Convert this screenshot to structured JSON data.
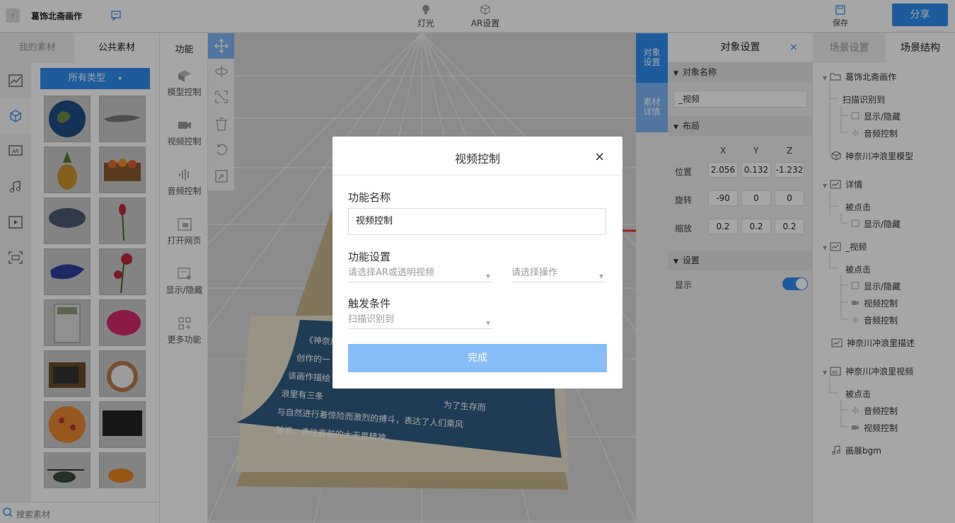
{
  "app": {
    "title": "葛饰北斋画作",
    "back_icon": "back-icon",
    "edit_icon": "comment-edit-icon"
  },
  "toolbar": {
    "light": {
      "label": "灯光",
      "icon": "bulb-icon"
    },
    "ar": {
      "label": "AR设置",
      "icon": "cube-icon"
    },
    "save": {
      "label": "保存",
      "icon": "save-icon"
    },
    "share": {
      "label": "分享"
    }
  },
  "left_panel": {
    "tabs": [
      "我的素材",
      "公共素材"
    ],
    "active_tab": "公共素材",
    "filter": {
      "label": "所有类型",
      "caret": "▾"
    },
    "search_placeholder": "搜索素材",
    "rail_icons": [
      "chart-icon",
      "cube-icon",
      "ar-icon",
      "music-icon",
      "video-icon",
      "scan-icon"
    ]
  },
  "func_panel": {
    "title": "功能",
    "items": [
      {
        "label": "模型控制",
        "icon": "model-control-icon"
      },
      {
        "label": "视频控制",
        "icon": "video-camera-icon"
      },
      {
        "label": "音频控制",
        "icon": "audio-wave-icon"
      },
      {
        "label": "打开网页",
        "icon": "webpage-icon"
      },
      {
        "label": "显示/隐藏",
        "icon": "visibility-icon"
      },
      {
        "label": "更多功能",
        "icon": "more-grid-icon"
      }
    ]
  },
  "canvas": {
    "card_lines": [
      "《神奈川",
      "创作的一",
      "该画作描绘",
      "浪里有三条",
      "与自然进行着惊险而激烈的搏斗，表达了人们乘风",
      "破浪、勇往直前的大无畏精神。"
    ],
    "card_line_mid": "为了生存而"
  },
  "side_tabs": {
    "tab1": "对象设置",
    "tab2": "素材详情"
  },
  "object_settings": {
    "title": "对象设置",
    "close": "×",
    "name_section": "对象名称",
    "name_value": "_视频",
    "layout_section": "布局",
    "axes": [
      "X",
      "Y",
      "Z"
    ],
    "rows": [
      {
        "label": "位置",
        "values": [
          "2.056",
          "0.132",
          "-1.232"
        ]
      },
      {
        "label": "旋转",
        "values": [
          "-90",
          "0",
          "0"
        ]
      },
      {
        "label": "缩放",
        "values": [
          "0.2",
          "0.2",
          "0.2"
        ]
      }
    ],
    "settings_section": "设置",
    "display_label": "显示",
    "display_on": true
  },
  "scene": {
    "tabs": [
      "场景设置",
      "场景结构"
    ],
    "active_tab": "场景结构",
    "tree": {
      "root": "葛饰北斋画作",
      "scan": "扫描识别到",
      "show_hide": "显示/隐藏",
      "audio": "音频控制",
      "model": "神奈川冲浪里模型",
      "detail": "详情",
      "clicked": "被点击",
      "video_node": "_视频",
      "video_ctrl": "视频控制",
      "desc": "神奈川冲浪里描述",
      "ar_video": "神奈川冲浪里视频",
      "bgm": "画展bgm"
    }
  },
  "modal": {
    "title": "视频控制",
    "close": "×",
    "name_label": "功能名称",
    "name_value": "视频控制",
    "settings_label": "功能设置",
    "select1": "请选择AR或透明视频",
    "select2": "请选择操作",
    "trigger_label": "触发条件",
    "trigger_value": "扫描识别到",
    "done": "完成"
  },
  "colors": {
    "accent": "#2d8cf0",
    "accent_light": "#86bdf8",
    "overlay": "rgba(0,0,0,0.35)"
  }
}
